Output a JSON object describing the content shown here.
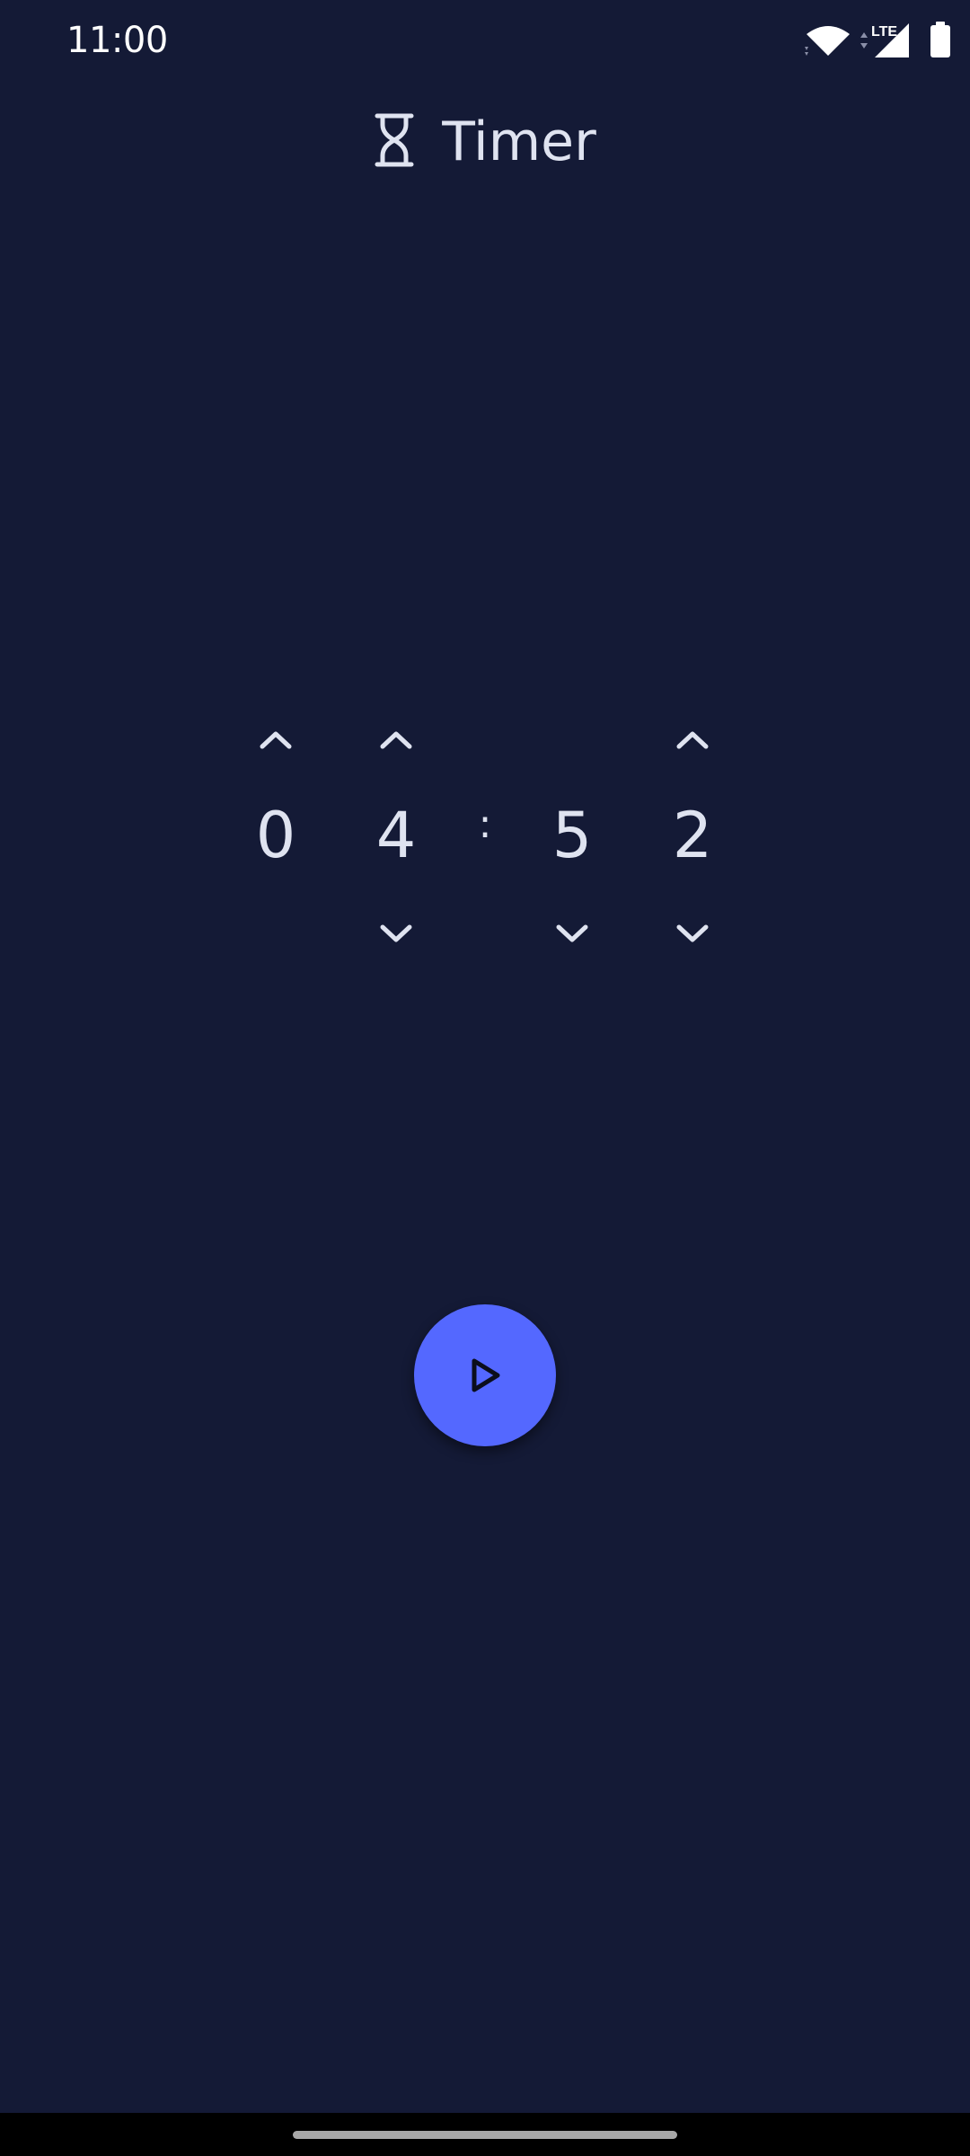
{
  "status_bar": {
    "time": "11:00",
    "network_label": "LTE",
    "icons": [
      "wifi-icon",
      "cell-signal-icon",
      "battery-icon"
    ]
  },
  "header": {
    "title": "Timer",
    "icon": "hourglass-icon"
  },
  "timer": {
    "digits": [
      "0",
      "4",
      "5",
      "2"
    ],
    "separator": ":"
  },
  "controls": {
    "start_icon": "play-icon"
  },
  "colors": {
    "background": "#141a36",
    "accent": "#5468ff",
    "text": "#dfe3f0"
  }
}
